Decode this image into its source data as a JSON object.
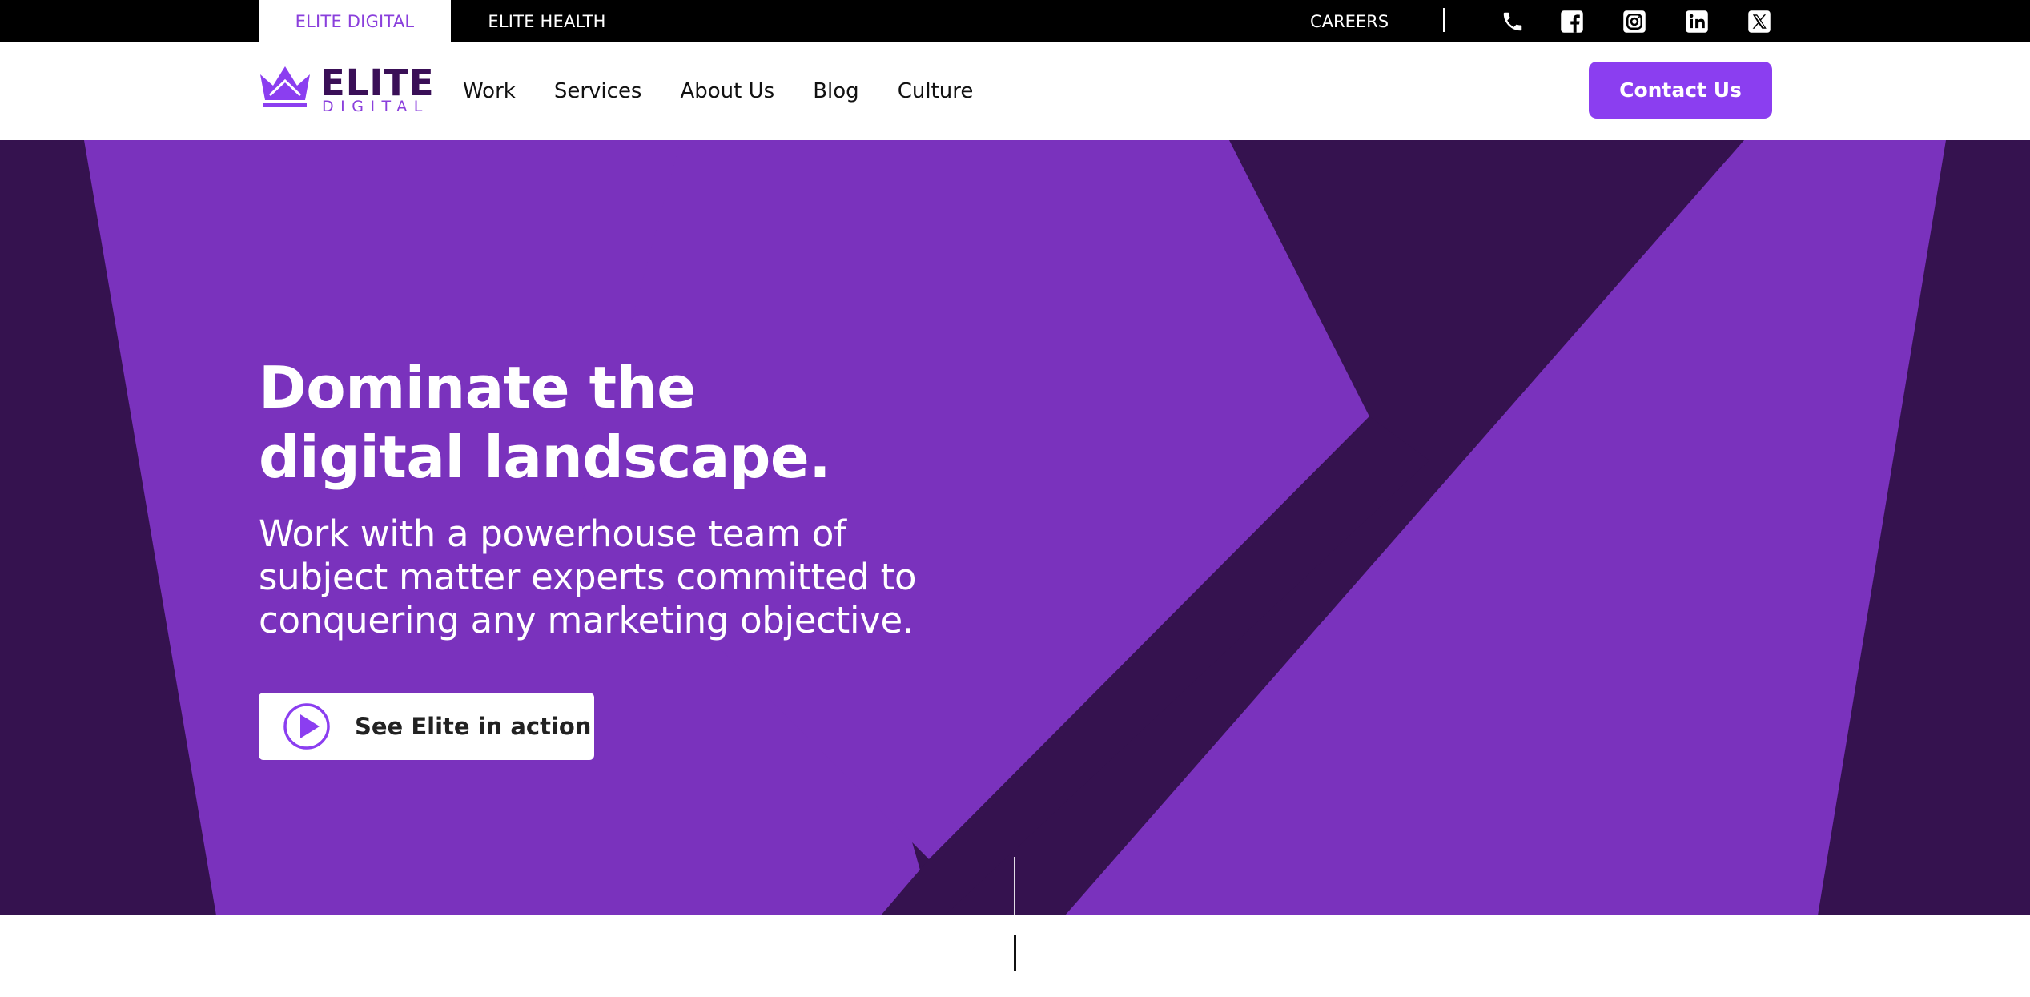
{
  "topbar": {
    "tabs": [
      {
        "label": "ELITE DIGITAL",
        "active": true
      },
      {
        "label": "ELITE HEALTH",
        "active": false
      }
    ],
    "careers_label": "CAREERS",
    "social_icons": [
      "phone-icon",
      "facebook-icon",
      "instagram-icon",
      "linkedin-icon",
      "x-twitter-icon"
    ]
  },
  "header": {
    "logo": {
      "main": "ELITE",
      "sub": "DIGITAL"
    },
    "nav": [
      "Work",
      "Services",
      "About Us",
      "Blog",
      "Culture"
    ],
    "contact_label": "Contact Us"
  },
  "hero": {
    "title_lines": [
      "Dominate the",
      "digital landscape."
    ],
    "subtitle_lines": [
      "Work with a powerhouse team of",
      "subject matter experts committed to",
      "conquering any marketing objective."
    ],
    "action_label": "See Elite in action"
  },
  "colors": {
    "accent": "#8b3ef0",
    "hero_light": "#7a32bd",
    "hero_dark": "#35124f",
    "logo_dark": "#3a0f57",
    "topbar_bg": "#000000"
  }
}
